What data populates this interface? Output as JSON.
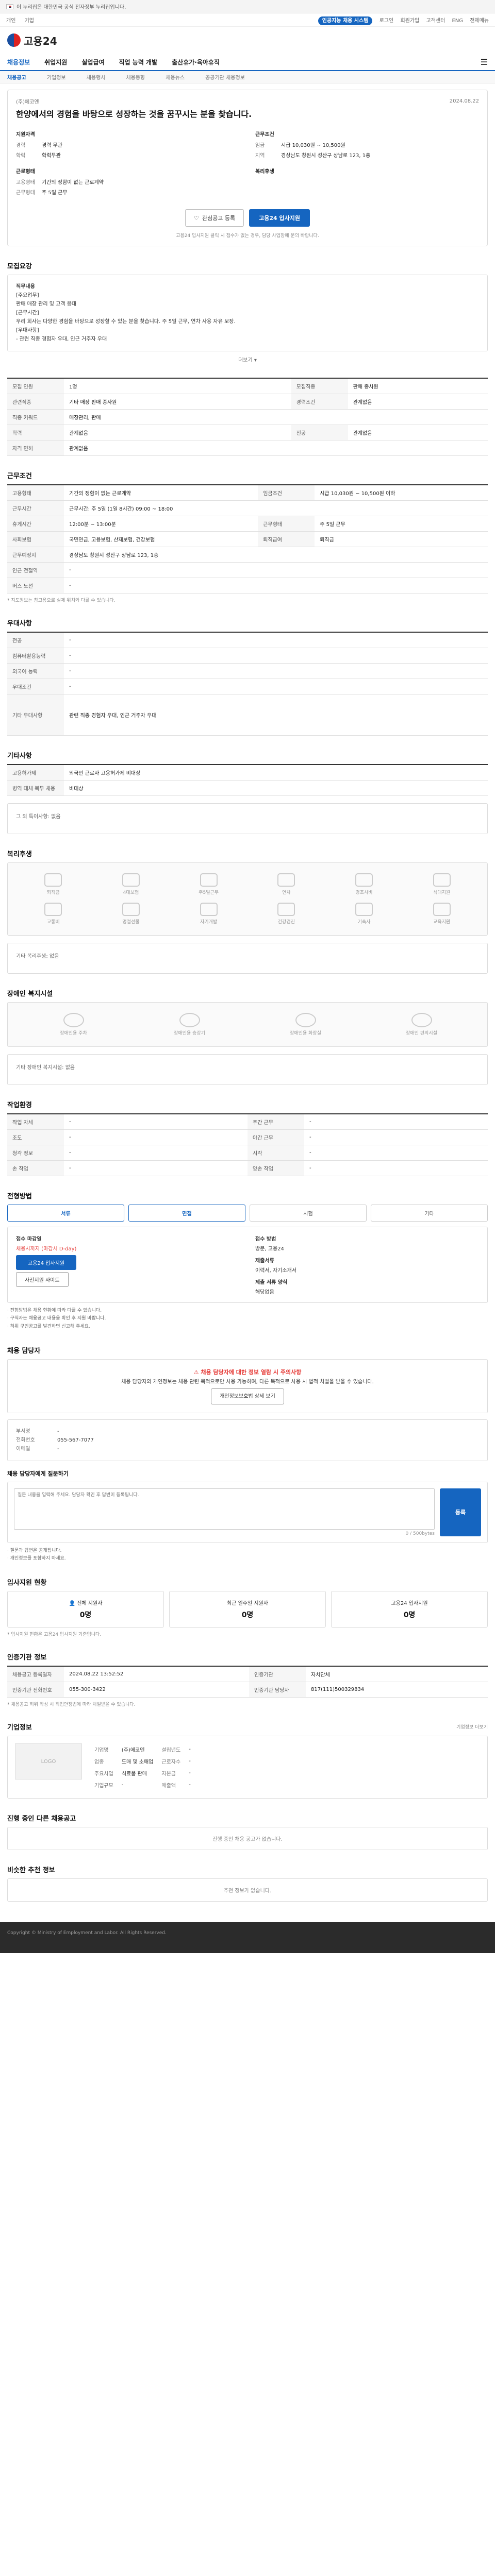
{
  "gov_banner": "이 누리집은 대한민국 공식 전자정부 누리집입니다.",
  "topbar": {
    "left": [
      "개인",
      "기업"
    ],
    "right": [
      "로그인",
      "회원가입",
      "고객센터",
      "ENG",
      "전체메뉴"
    ],
    "ai": "인공지능 채용 시스템"
  },
  "logo": "고용24",
  "gnb": {
    "items": [
      "채용정보",
      "취업지원",
      "실업급여",
      "직업 능력 개발",
      "출산휴가·육아휴직"
    ],
    "allmenu_icon": "menu-icon"
  },
  "sub_nav": [
    "채용공고",
    "기업정보",
    "채용행사",
    "채용동향",
    "채용뉴스",
    "공공기관 채용정보"
  ],
  "hero": {
    "company": "(주)에코엔",
    "date": "2024.08.22",
    "title": "한양에서의 경험을 바탕으로 성장하는 것을 꿈꾸시는 분을 찾습니다.",
    "left": [
      {
        "h": "지원자격",
        "rows": [
          [
            "경력",
            "경력 무관"
          ],
          [
            "학력",
            "학력무관"
          ]
        ]
      },
      {
        "h": "근로형태",
        "rows": [
          [
            "고용형태",
            "기간의 정함이 없는 근로계약"
          ],
          [
            "근무형태",
            "주 5일 근무"
          ]
        ]
      }
    ],
    "right": [
      {
        "h": "근무조건",
        "rows": [
          [
            "임금",
            "시급 10,030원 ~ 10,500원"
          ],
          [
            "지역",
            "경상남도 창원시 성산구 상남로 123, 1층"
          ]
        ]
      },
      {
        "h": "복리후생",
        "rows": []
      }
    ],
    "btn_fav": "관심공고 등록",
    "btn_apply": "고용24 입사지원",
    "note": "고용24 입사지원 클릭 시 접수가 없는 경우, 담당 사업장에 문의 바랍니다."
  },
  "job_desc": {
    "title": "모집요강",
    "body": [
      "직무내용",
      "[주요업무]",
      "판매 매장 관리 및 고객 응대",
      "[근무시간]",
      "우리 회사는 다양한 경험을 바탕으로 성장할 수 있는 분을 찾습니다. 주 5일 근무, 연차 사용 자유 보장.",
      "[우대사항]",
      "- 관련 직종 경험자 우대, 인근 거주자 우대"
    ],
    "more": "더보기 ▾"
  },
  "req_table": [
    [
      "모집 인원",
      "1명",
      "모집직종",
      "판매 종사원"
    ],
    [
      "관련직종",
      "기타 매장 판매 종사원",
      "경력조건",
      "관계없음"
    ],
    [
      "직종 키워드",
      "매장관리, 판매",
      "",
      ""
    ],
    [
      "학력",
      "관계없음",
      "전공",
      "관계없음"
    ],
    [
      "자격 면허",
      "관계없음",
      "",
      ""
    ]
  ],
  "work": {
    "title": "근무조건",
    "rows": [
      [
        "고용형태",
        "기간의 정함이 없는 근로계약",
        "임금조건",
        "시급 10,030원 ~ 10,500원 이하"
      ],
      [
        "근무시간",
        "근무시간: 주 5일 (1일 8시간) 09:00 ~ 18:00",
        "",
        ""
      ],
      [
        "휴게시간",
        "12:00분 ~ 13:00분",
        "근무형태",
        "주 5일 근무"
      ],
      [
        "사회보험",
        "국민연금, 고용보험, 산재보험, 건강보험",
        "퇴직급여",
        "퇴직금"
      ],
      [
        "근무예정지",
        "경상남도 창원시 성산구 상남로 123, 1층",
        "",
        ""
      ],
      [
        "인근 전철역",
        "-",
        "",
        ""
      ],
      [
        "버스 노선",
        "-",
        "",
        ""
      ]
    ],
    "note": "* 지도정보는 참고용으로 실제 위치와 다를 수 있습니다."
  },
  "pref": {
    "title": "우대사항",
    "rows": [
      [
        "전공",
        "-"
      ],
      [
        "컴퓨터활용능력",
        "-"
      ],
      [
        "외국어 능력",
        "-"
      ],
      [
        "우대조건",
        "-"
      ],
      [
        "기타 우대사항",
        "관련 직종 경험자 우대, 인근 거주자 우대"
      ]
    ]
  },
  "etc": {
    "title": "기타사항",
    "rows": [
      [
        "고용허가제",
        "외국인 근로자 고용허가제 비대상"
      ],
      [
        "병역 대체 복무 채용",
        "비대상"
      ]
    ],
    "empty": "그 외 특이사항: 없음"
  },
  "welfare": {
    "title": "복리후생",
    "icons": [
      "퇴직금",
      "4대보험",
      "주5일근무",
      "연차",
      "경조사비",
      "식대지원",
      "교통비",
      "명절선물",
      "자기개발",
      "건강검진",
      "기숙사",
      "교육지원"
    ],
    "etc": "기타 복리후생: 없음"
  },
  "disability": {
    "title": "장애인 복지시설",
    "icons": [
      "장애인용 주차",
      "장애인용 승강기",
      "장애인용 화장실",
      "장애인 편의시설"
    ],
    "etc": "기타 장애인 복지시설: 없음"
  },
  "company_env": {
    "title": "작업환경",
    "rows": [
      [
        "작업 자세",
        "-",
        "주간 근무",
        "-"
      ],
      [
        "조도",
        "-",
        "야간 근무",
        "-"
      ],
      [
        "청각 정보",
        "-",
        "시각",
        "-"
      ],
      [
        "손 작업",
        "-",
        "양손 작업",
        "-"
      ]
    ]
  },
  "process": {
    "title": "전형방법",
    "steps": [
      "서류",
      "면접",
      "시험",
      "기타"
    ],
    "apply": {
      "period_h": "접수 마감일",
      "period": "채용시까지 (마감시 D-day)",
      "method_h": "접수 방법",
      "method": "방문, 고용24",
      "docs_h": "제출서류",
      "docs": "이력서, 자기소개서",
      "lang_h": "제출 서류 양식",
      "lang": "해당없음",
      "btn1": "고용24 입사지원",
      "btn2": "사전지원 사이트"
    },
    "bullets": [
      "· 전형방법은 채용 현황에 따라 다를 수 있습니다.",
      "· 구직자는 채용공고 내용을 확인 후 지원 바랍니다.",
      "· 허위 구인공고를 발견하면 신고해 주세요."
    ]
  },
  "contact": {
    "title": "채용 담당자",
    "warn_h": "채용 담당자에 대한 정보 열람 시 주의사항",
    "warn": "채용 담당자의 개인정보는 채용 관련 목적으로만 사용 가능하며, 다른 목적으로 사용 시 법적 처벌을 받을 수 있습니다.",
    "warn_btn": "개인정보보호법 상세 보기",
    "name_k": "부서명",
    "name_v": "-",
    "tel_k": "전화번호",
    "tel_v": "055-567-7077",
    "email_k": "이메일",
    "email_v": "-",
    "q_title": "채용 담당자에게 질문하기",
    "q_ph": "질문 내용을 입력해 주세요. 담당자 확인 후 답변이 등록됩니다.",
    "q_btn": "등록",
    "q_count": "0 / 500bytes",
    "q_notes": [
      "· 질문과 답변은 공개됩니다.",
      "· 개인정보를 포함하지 마세요."
    ]
  },
  "stats": {
    "title": "입사지원 현황",
    "items": [
      [
        "전체 지원자",
        "0명"
      ],
      [
        "최근 일주일 지원자",
        "0명"
      ],
      [
        "고용24 입사지원",
        "0명"
      ]
    ],
    "note": "* 입사지원 현황은 고용24 입사지원 기준입니다."
  },
  "org": {
    "title": "인증기관 정보",
    "rows": [
      [
        "채용공고 등록일자",
        "2024.08.22 13:52:52",
        "인증기관",
        "자치단체",
        ""
      ],
      [
        "인증기관 전화번호",
        "055-300-3422",
        "인증기관 담당자",
        "817(111)500329834",
        ""
      ]
    ],
    "note": "* 채용공고 허위 작성 시 직업안정법에 따라 처벌받을 수 있습니다."
  },
  "corp": {
    "title": "기업정보",
    "logo": "LOGO",
    "rows": [
      [
        "기업명",
        "(주)에코엔"
      ],
      [
        "업종",
        "도매 및 소매업"
      ],
      [
        "주요사업",
        "식료품 판매"
      ],
      [
        "기업규모",
        "-"
      ]
    ],
    "rows2": [
      [
        "설립년도",
        "-"
      ],
      [
        "근로자수",
        "-"
      ],
      [
        "자본금",
        "-"
      ],
      [
        "매출액",
        "-"
      ]
    ],
    "btn": "기업정보 더보기"
  },
  "related": {
    "title": "진행 중인 다른 채용공고",
    "empty": "진행 중인 채용 공고가 없습니다."
  },
  "recommend": {
    "title": "비슷한 추천 정보",
    "empty": "추천 정보가 없습니다."
  },
  "footer": "Copyright © Ministry of Employment and Labor. All Rights Reserved."
}
